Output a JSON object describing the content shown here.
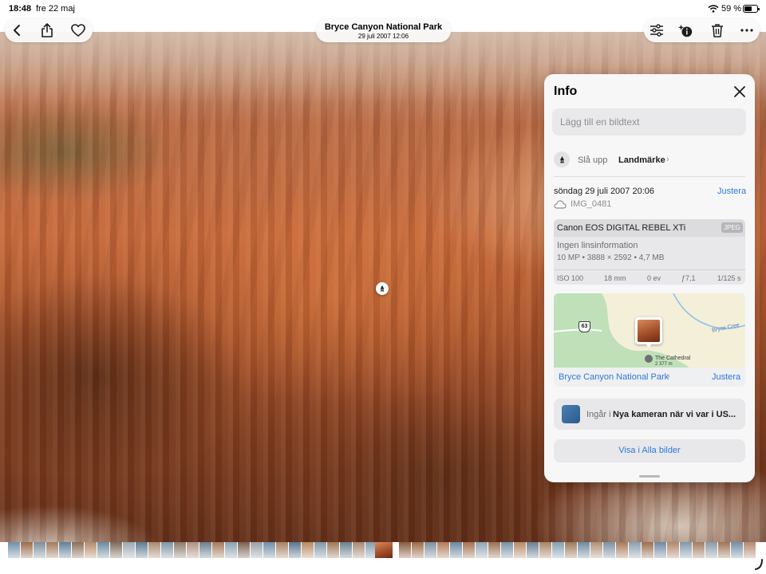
{
  "status_bar": {
    "time": "18:48",
    "date": "fre 22 maj",
    "battery_percent": "59 %",
    "battery_level": 0.59
  },
  "nav": {
    "title": "Bryce Canyon National Park",
    "subtitle": "29 juli 2007  12:06",
    "left_icons": [
      "chevron-left-icon",
      "share-icon",
      "heart-icon"
    ],
    "right_icons": [
      "adjust-sliders-icon",
      "info-sparkle-icon",
      "trash-icon",
      "more-icon"
    ]
  },
  "info_panel": {
    "title": "Info",
    "caption_placeholder": "Lägg till en bildtext",
    "landmark": {
      "prefix": "Slå upp",
      "strong": "Landmärke"
    },
    "date_time": "söndag 29 juli 2007 20:06",
    "adjust_label": "Justera",
    "file_name": "IMG_0481",
    "camera": {
      "model": "Canon EOS DIGITAL REBEL XTi",
      "format": "JPEG",
      "lens": "Ingen linsinformation",
      "specs": "10 MP • 3888 × 2592 • 4,7 MB",
      "exif": [
        "ISO 100",
        "18 mm",
        "0 ev",
        "ƒ7,1",
        "1/125 s"
      ]
    },
    "map": {
      "place": "Bryce Canyon National Park",
      "adjust_label": "Justera",
      "poi": "The Cathedral",
      "elevation": "2 377 m",
      "creek": "Bryce Cree",
      "route": "63"
    },
    "album": {
      "prefix": "Ingår i",
      "name": "Nya kameran när vi var i US..."
    },
    "show_all": "Visa i Alla bilder"
  },
  "colors": {
    "accent": "#2f78d8",
    "panel_bg": "#f7f7f8",
    "map_green": "#bfe0b8",
    "map_land": "#f3efd9"
  },
  "filmstrip": {
    "thumbnail_colors": [
      "#6e8fa8",
      "#9b6a4a",
      "#7a8f9c",
      "#a07a5c",
      "#5e7f99",
      "#8a6e58",
      "#b58a6a",
      "#6a8aa0",
      "#7e6a5a",
      "#9aa8b0",
      "#5f7a8f",
      "#a88a70",
      "#7d95a8",
      "#8c7a6a",
      "#b09080",
      "#6a7f90",
      "#a47a5a",
      "#8aa0b0",
      "#7a6050",
      "#9aa0a6",
      "#6f8ea6",
      "#a88060",
      "#5a7590",
      "#b88a60",
      "#7f96aa",
      "#9c7858",
      "#6a8090",
      "#a58a72",
      "#859db0",
      "#8a6a50"
    ],
    "thumbnail_colors_right": [
      "#8a5a3a",
      "#9c6a48",
      "#7a8fa0",
      "#b07a58",
      "#6a86a0",
      "#a47050",
      "#8fa4b4",
      "#9a7052",
      "#7890a4",
      "#b58a66",
      "#6a7d90",
      "#a88466",
      "#82a0b4",
      "#9c7a5c",
      "#6f8aa0",
      "#b09076",
      "#7a92a6",
      "#a87a58",
      "#8a9fb0",
      "#9a6e4e",
      "#6e88a0",
      "#b0866a",
      "#7f98ac",
      "#a47c5e",
      "#8a9aa8",
      "#9e7456",
      "#748ea4",
      "#b58a70"
    ]
  }
}
